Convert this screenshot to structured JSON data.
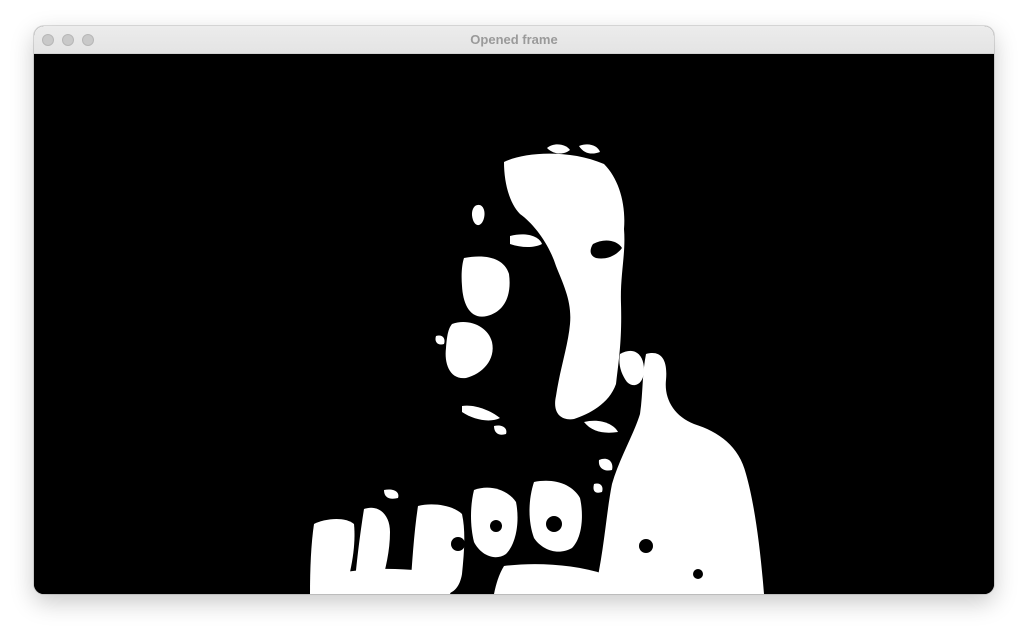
{
  "window": {
    "title": "Opened frame",
    "buttons": [
      "close",
      "minimize",
      "maximize"
    ]
  },
  "frame": {
    "description_icon": "binary-mask-image",
    "foreground_color": "#ffffff",
    "background_color": "#000000"
  }
}
